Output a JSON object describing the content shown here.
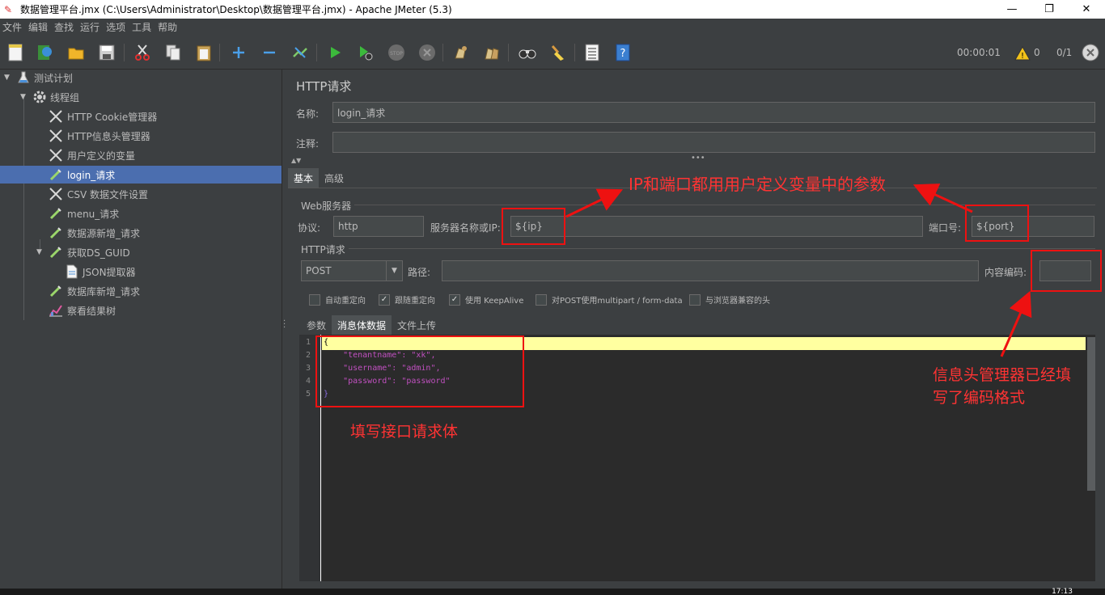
{
  "window": {
    "title": "数据管理平台.jmx (C:\\Users\\Administrator\\Desktop\\数据管理平台.jmx) - Apache JMeter (5.3)"
  },
  "menu": [
    "文件",
    "编辑",
    "查找",
    "运行",
    "选项",
    "工具",
    "帮助"
  ],
  "toolbar": {
    "timer": "00:00:01",
    "warnings": "0",
    "threads": "0/1"
  },
  "tree": {
    "items": [
      {
        "label": "测试计划",
        "icon": "flask-icon"
      },
      {
        "label": "线程组",
        "icon": "gear-icon"
      },
      {
        "label": "HTTP Cookie管理器",
        "icon": "wrench-icon"
      },
      {
        "label": "HTTP信息头管理器",
        "icon": "wrench-icon"
      },
      {
        "label": "用户定义的变量",
        "icon": "wrench-icon"
      },
      {
        "label": "login_请求",
        "icon": "pipette-icon"
      },
      {
        "label": "CSV 数据文件设置",
        "icon": "wrench-icon"
      },
      {
        "label": "menu_请求",
        "icon": "pipette-icon"
      },
      {
        "label": "数据源新增_请求",
        "icon": "pipette-icon"
      },
      {
        "label": "获取DS_GUID",
        "icon": "pipette-icon"
      },
      {
        "label": "JSON提取器",
        "icon": "document-icon"
      },
      {
        "label": "数据库新增_请求",
        "icon": "pipette-icon"
      },
      {
        "label": "察看结果树",
        "icon": "chart-icon"
      }
    ]
  },
  "panel": {
    "heading": "HTTP请求",
    "name_label": "名称:",
    "name_value": "login_请求",
    "comment_label": "注释:",
    "comment_value": "",
    "tabs": [
      "基本",
      "高级"
    ],
    "web_server_legend": "Web服务器",
    "protocol_label": "协议:",
    "protocol_value": "http",
    "server_label": "服务器名称或IP:",
    "server_value": "${ip}",
    "port_label": "端口号:",
    "port_value": "${port}",
    "http_request_legend": "HTTP请求",
    "method_value": "POST",
    "path_label": "路径:",
    "path_value": "",
    "encoding_label": "内容编码:",
    "encoding_value": "",
    "checkboxes": [
      {
        "label": "自动重定向",
        "checked": false
      },
      {
        "label": "跟随重定向",
        "checked": true
      },
      {
        "label": "使用 KeepAlive",
        "checked": true
      },
      {
        "label": "对POST使用multipart / form-data",
        "checked": false
      },
      {
        "label": "与浏览器兼容的头",
        "checked": false
      }
    ],
    "subtabs": [
      "参数",
      "消息体数据",
      "文件上传"
    ]
  },
  "editor": {
    "line_numbers": [
      "1",
      "2",
      "3",
      "4",
      "5"
    ],
    "lines": [
      "{",
      "    \"tenantname\": \"xk\",",
      "    \"username\": \"admin\",",
      "    \"password\": \"password\"",
      "}"
    ]
  },
  "annotations": {
    "top": "IP和端口都用用户定义变量中的参数",
    "body": "填写接口请求体",
    "header_line1": "信息头管理器已经填",
    "header_line2": "写了编码格式",
    "color": "#ff3333"
  },
  "taskbar": {
    "clock": "17:13"
  }
}
